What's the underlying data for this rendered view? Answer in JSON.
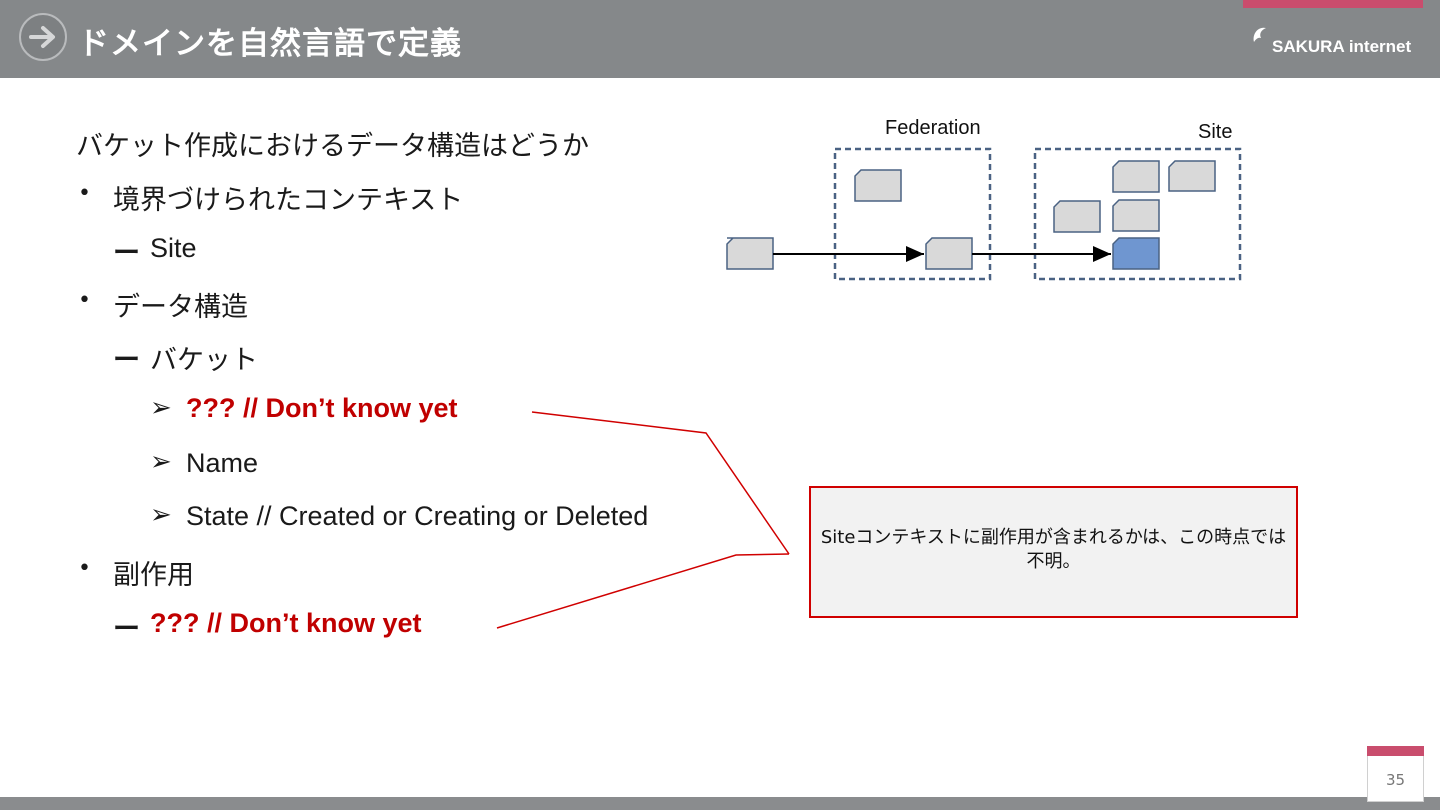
{
  "header": {
    "title": "ドメインを自然言語で定義",
    "logo_text": "SAKURA internet",
    "nav_icon": "arrow-right-icon"
  },
  "body": {
    "heading": "バケット作成におけるデータ構造はどうか",
    "items": [
      {
        "marker": "•",
        "text": "境界づけられたコンテキスト"
      },
      {
        "marker": "ー",
        "text": "Site"
      },
      {
        "marker": "•",
        "text": "データ構造"
      },
      {
        "marker": "ー",
        "text": "バケット"
      },
      {
        "marker": "➢",
        "text": "??? // Don’t know yet"
      },
      {
        "marker": "➢",
        "text": "Name"
      },
      {
        "marker": "➢",
        "text": "State // Created or Creating or Deleted"
      },
      {
        "marker": "•",
        "text": "副作用"
      },
      {
        "marker": "ー",
        "text": "??? // Don’t know yet"
      }
    ]
  },
  "callout": {
    "text": "Siteコンテキストに副作用が含まれるかは、この時点では不明。"
  },
  "diagram": {
    "federation_label": "Federation",
    "site_label": "Site"
  },
  "colors": {
    "header_bg": "#85888a",
    "accent": "#c94d6d",
    "red_text": "#c00000",
    "card_fill": "#d9d9d9",
    "card_highlight": "#6f96d0",
    "dashed_border": "#4a6283"
  },
  "footer": {
    "page_number": "35"
  }
}
